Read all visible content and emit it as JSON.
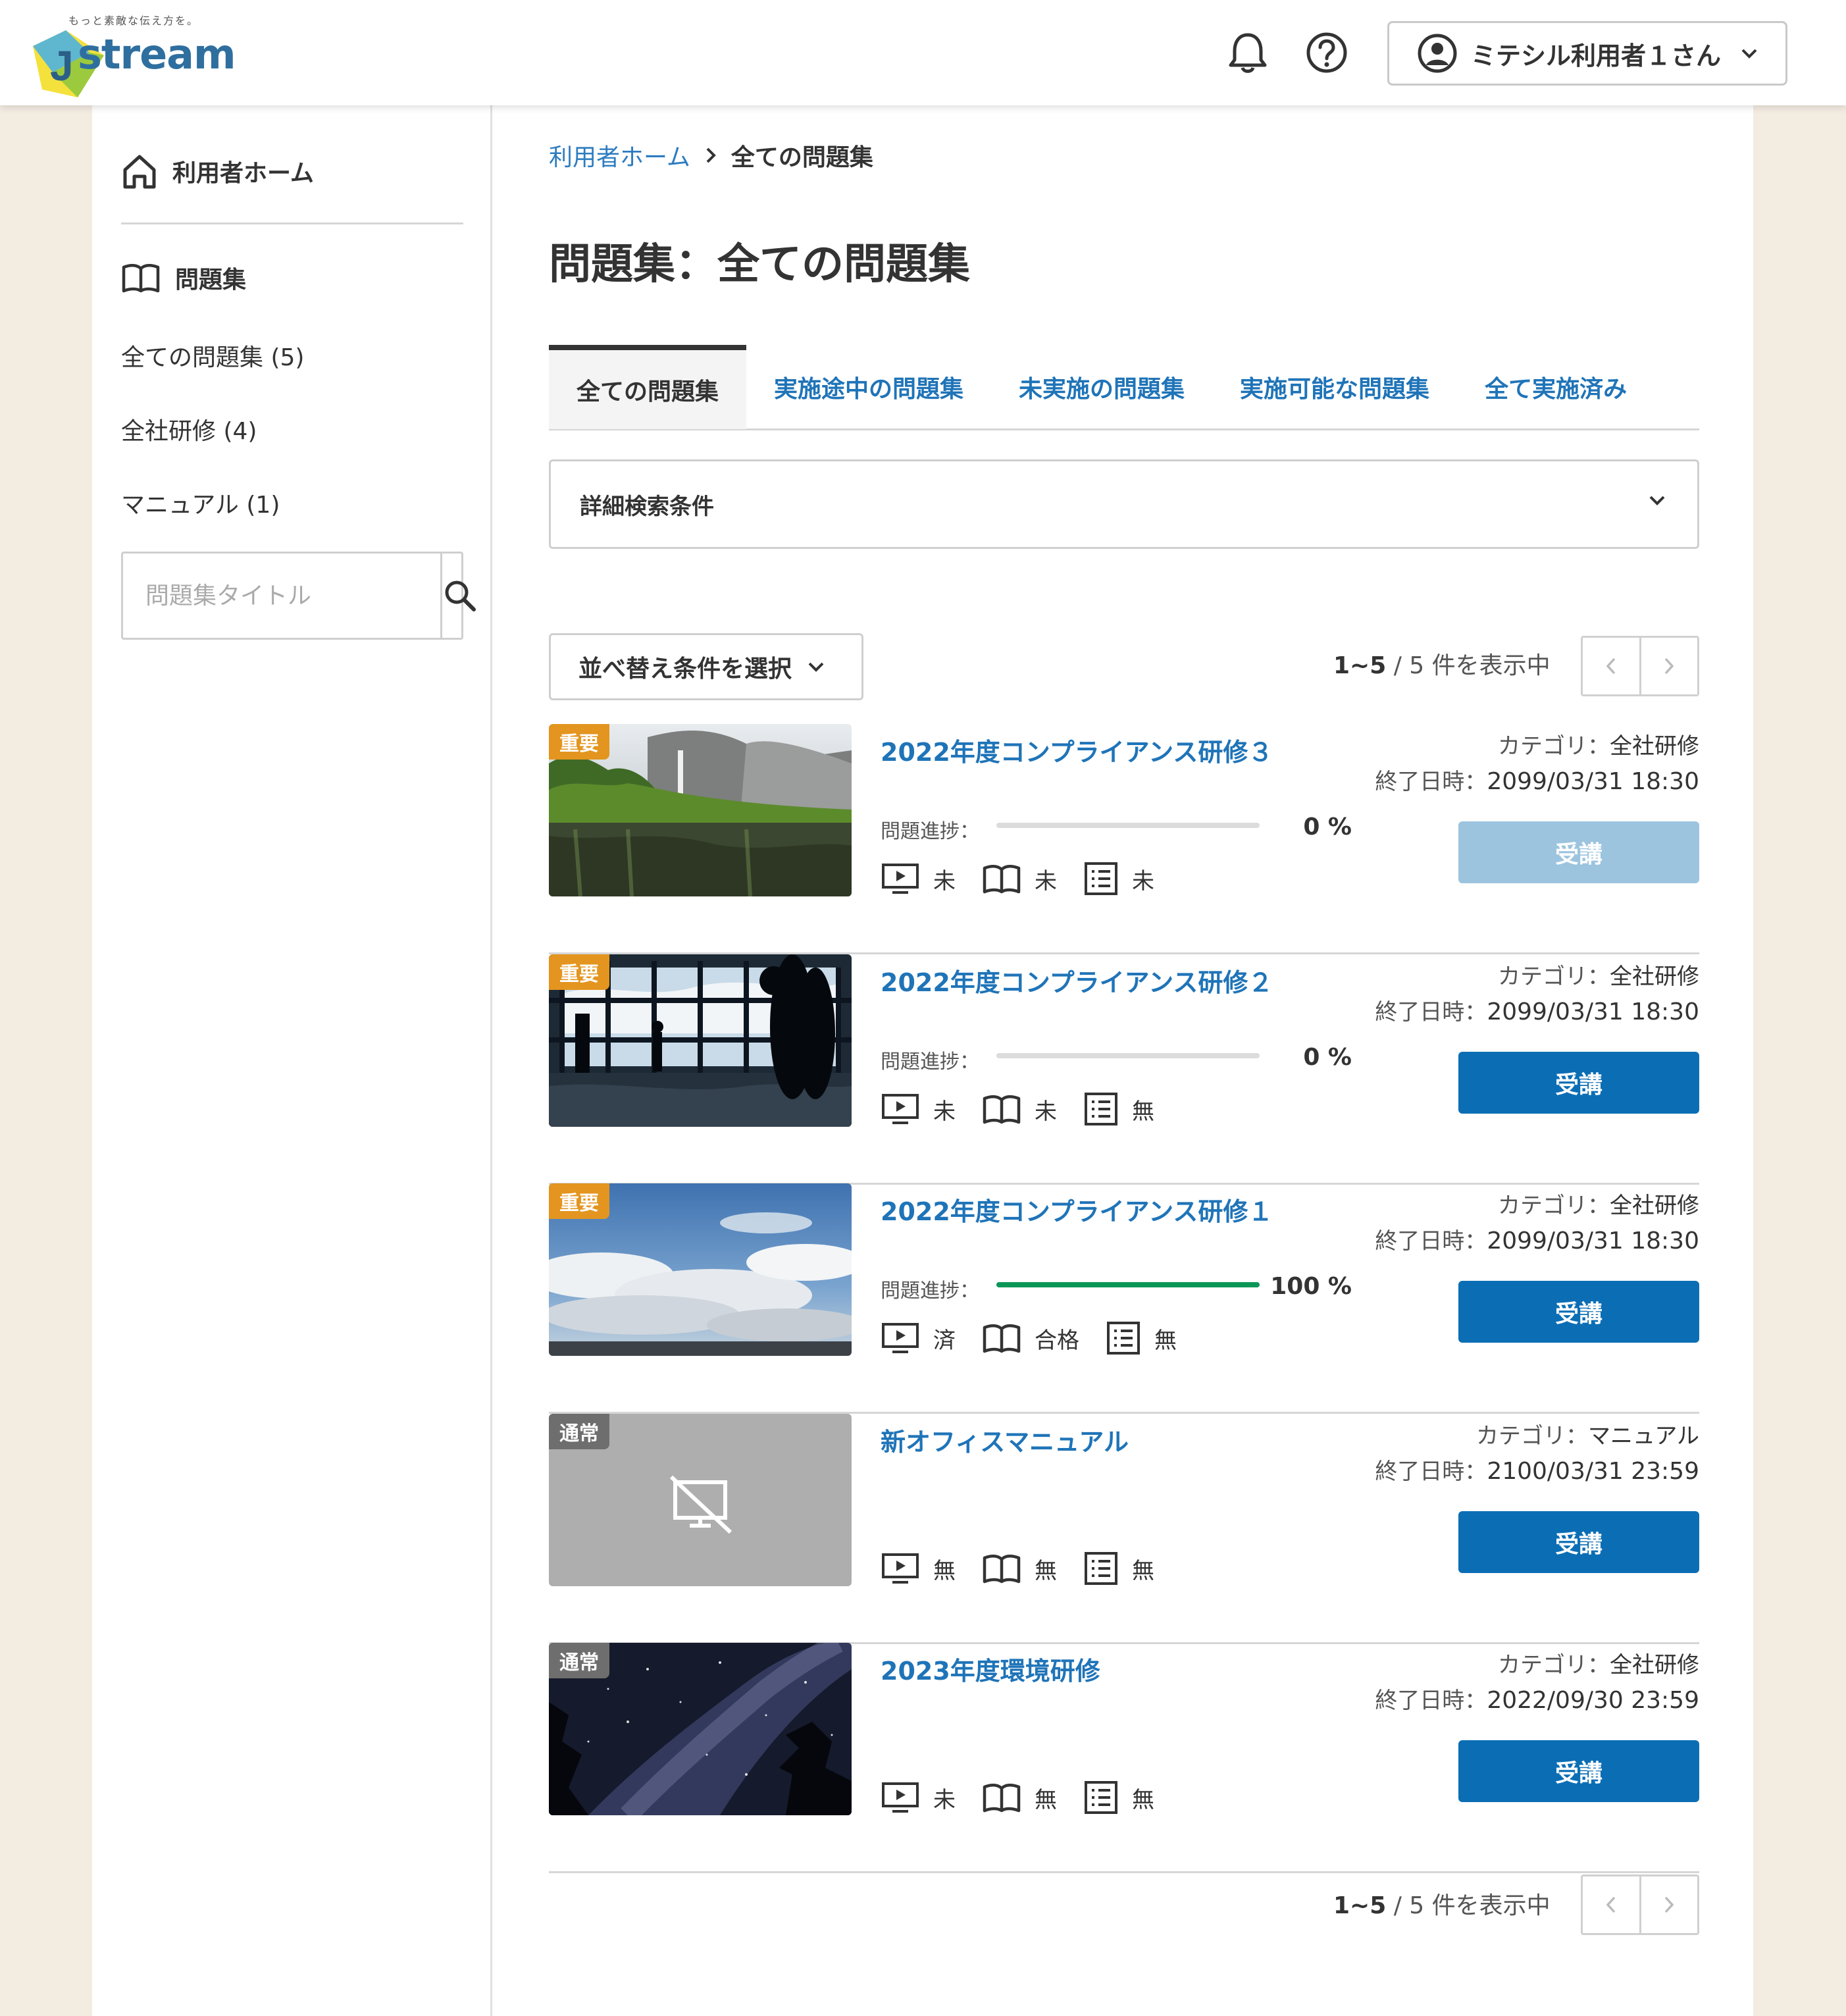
{
  "header": {
    "logo_tagline": "もっと素敵な伝え方を。",
    "logo_text": "stream",
    "logo_initial": "J",
    "user_label": "ミテシル利用者１さん",
    "icons": [
      "bell-icon",
      "help-circle-icon",
      "user-circle-icon",
      "chevron-down-icon"
    ]
  },
  "sidebar": {
    "home_label": "利用者ホーム",
    "section_label": "問題集",
    "items": [
      {
        "label": "全ての問題集 (5)"
      },
      {
        "label": "全社研修 (4)"
      },
      {
        "label": "マニュアル (1)"
      }
    ],
    "search_placeholder": "問題集タイトル"
  },
  "main": {
    "breadcrumb": {
      "home": "利用者ホーム",
      "current": "全ての問題集"
    },
    "title": "問題集：全ての問題集",
    "tabs": [
      {
        "label": "全ての問題集",
        "active": true
      },
      {
        "label": "実施途中の問題集"
      },
      {
        "label": "未実施の問題集"
      },
      {
        "label": "実施可能な問題集"
      },
      {
        "label": "全て実施済み"
      }
    ],
    "filter_label": "詳細検索条件",
    "sort_label": "並べ替え条件を選択",
    "pager": {
      "range": "1~5",
      "total": "/ 5 件を表示中"
    },
    "progress_label": "問題進捗：",
    "category_prefix": "カテゴリ：",
    "end_prefix": "終了日時：",
    "cards": [
      {
        "badge": "重要",
        "badge_type": "imp",
        "title": "2022年度コンプライアンス研修３",
        "progress": 0,
        "progress_text": "0 %",
        "video": "未",
        "book": "未",
        "list": "未",
        "category": "全社研修",
        "end": "2099/03/31 18:30",
        "button": "受講",
        "button_disabled": true
      },
      {
        "badge": "重要",
        "badge_type": "imp",
        "title": "2022年度コンプライアンス研修２",
        "progress": 0,
        "progress_text": "0 %",
        "video": "未",
        "book": "未",
        "list": "無",
        "category": "全社研修",
        "end": "2099/03/31 18:30",
        "button": "受講"
      },
      {
        "badge": "重要",
        "badge_type": "imp",
        "title": "2022年度コンプライアンス研修１",
        "progress": 100,
        "progress_text": "100 %",
        "video": "済",
        "book": "合格",
        "list": "無",
        "category": "全社研修",
        "end": "2099/03/31 18:30",
        "button": "受講"
      },
      {
        "badge": "通常",
        "badge_type": "norm",
        "title": "新オフィスマニュアル",
        "video": "無",
        "book": "無",
        "list": "無",
        "category": "マニュアル",
        "end": "2100/03/31 23:59",
        "button": "受講"
      },
      {
        "badge": "通常",
        "badge_type": "norm",
        "title": "2023年度環境研修",
        "video": "未",
        "book": "無",
        "list": "無",
        "category": "全社研修",
        "end": "2022/09/30 23:59",
        "button": "受講"
      }
    ]
  },
  "colors": {
    "accent": "#0b6eb5",
    "link": "#1f74b8",
    "badge_important": "#e3951f",
    "badge_normal": "#6e6e6e",
    "progress": "#0a9657",
    "page_bg": "#f3ece1"
  }
}
